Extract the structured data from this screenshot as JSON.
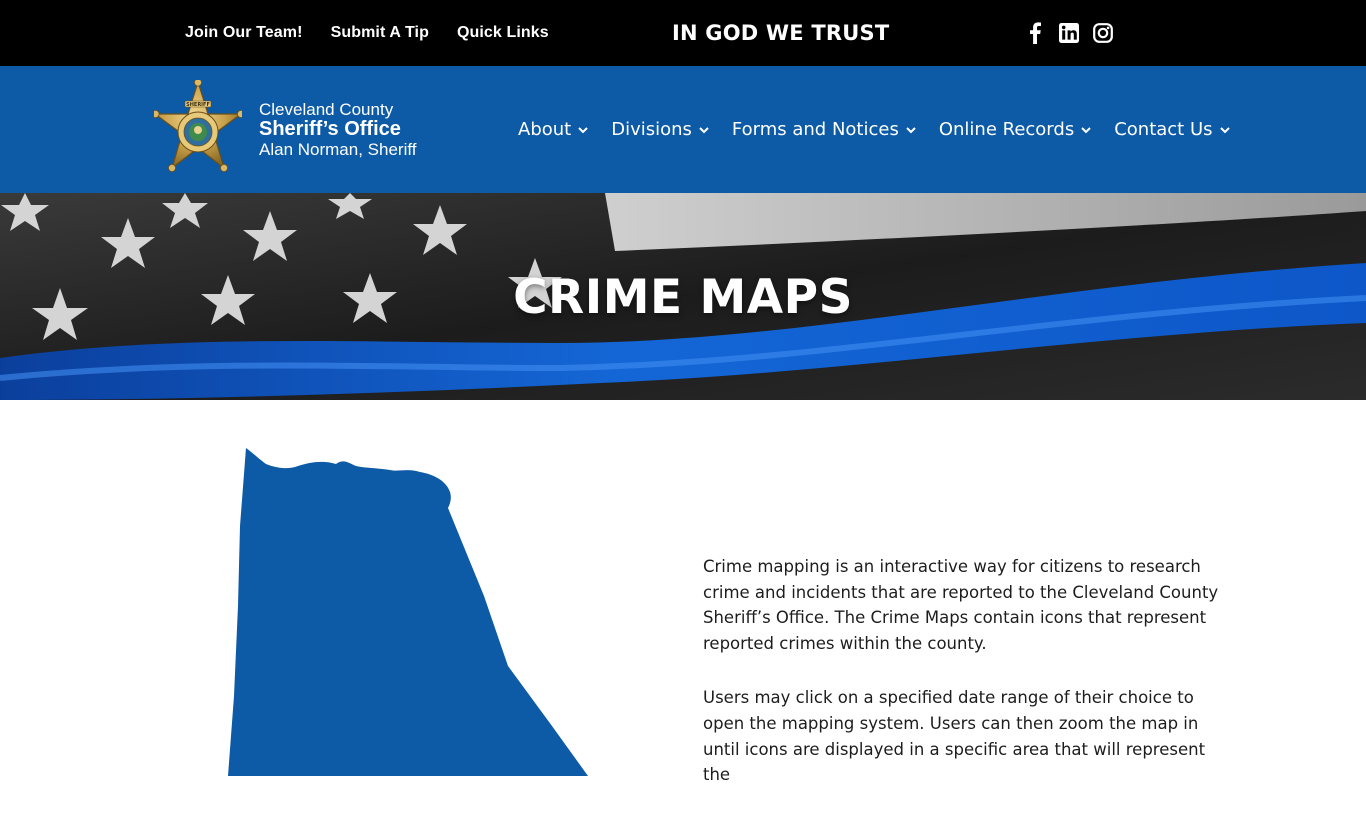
{
  "topbar": {
    "links": [
      {
        "label": "Join Our Team!"
      },
      {
        "label": "Submit A Tip"
      },
      {
        "label": "Quick Links"
      }
    ],
    "motto": "IN GOD WE TRUST",
    "social": [
      "facebook-icon",
      "linkedin-icon",
      "instagram-icon"
    ]
  },
  "header": {
    "brand": {
      "line1": "Cleveland County",
      "line2": "Sheriff’s Office",
      "line3": "Alan Norman, Sheriff"
    },
    "badge": {
      "top": "SHERIFF",
      "ring_top": "CLEVELAND COUNTY",
      "ring_bottom": "SHERIFF'S OFFICE"
    },
    "nav": [
      {
        "label": "About"
      },
      {
        "label": "Divisions"
      },
      {
        "label": "Forms and Notices"
      },
      {
        "label": "Online Records"
      },
      {
        "label": "Contact Us"
      }
    ]
  },
  "hero": {
    "title": "CRIME MAPS"
  },
  "content": {
    "paragraphs": [
      "Crime mapping is an interactive way for citizens to research crime and incidents that are reported to the Cleveland County Sheriff’s Office. The Crime Maps contain icons that represent reported crimes within the county.",
      "Users may click on a specified date range of their choice to open the mapping system. Users can then zoom the map in until icons are displayed in a specific area that will represent the"
    ]
  },
  "colors": {
    "topbar": "#000000",
    "header": "#0d5aa7",
    "map_fill": "#0d5aa7",
    "hero_blue": "#1466d6"
  }
}
